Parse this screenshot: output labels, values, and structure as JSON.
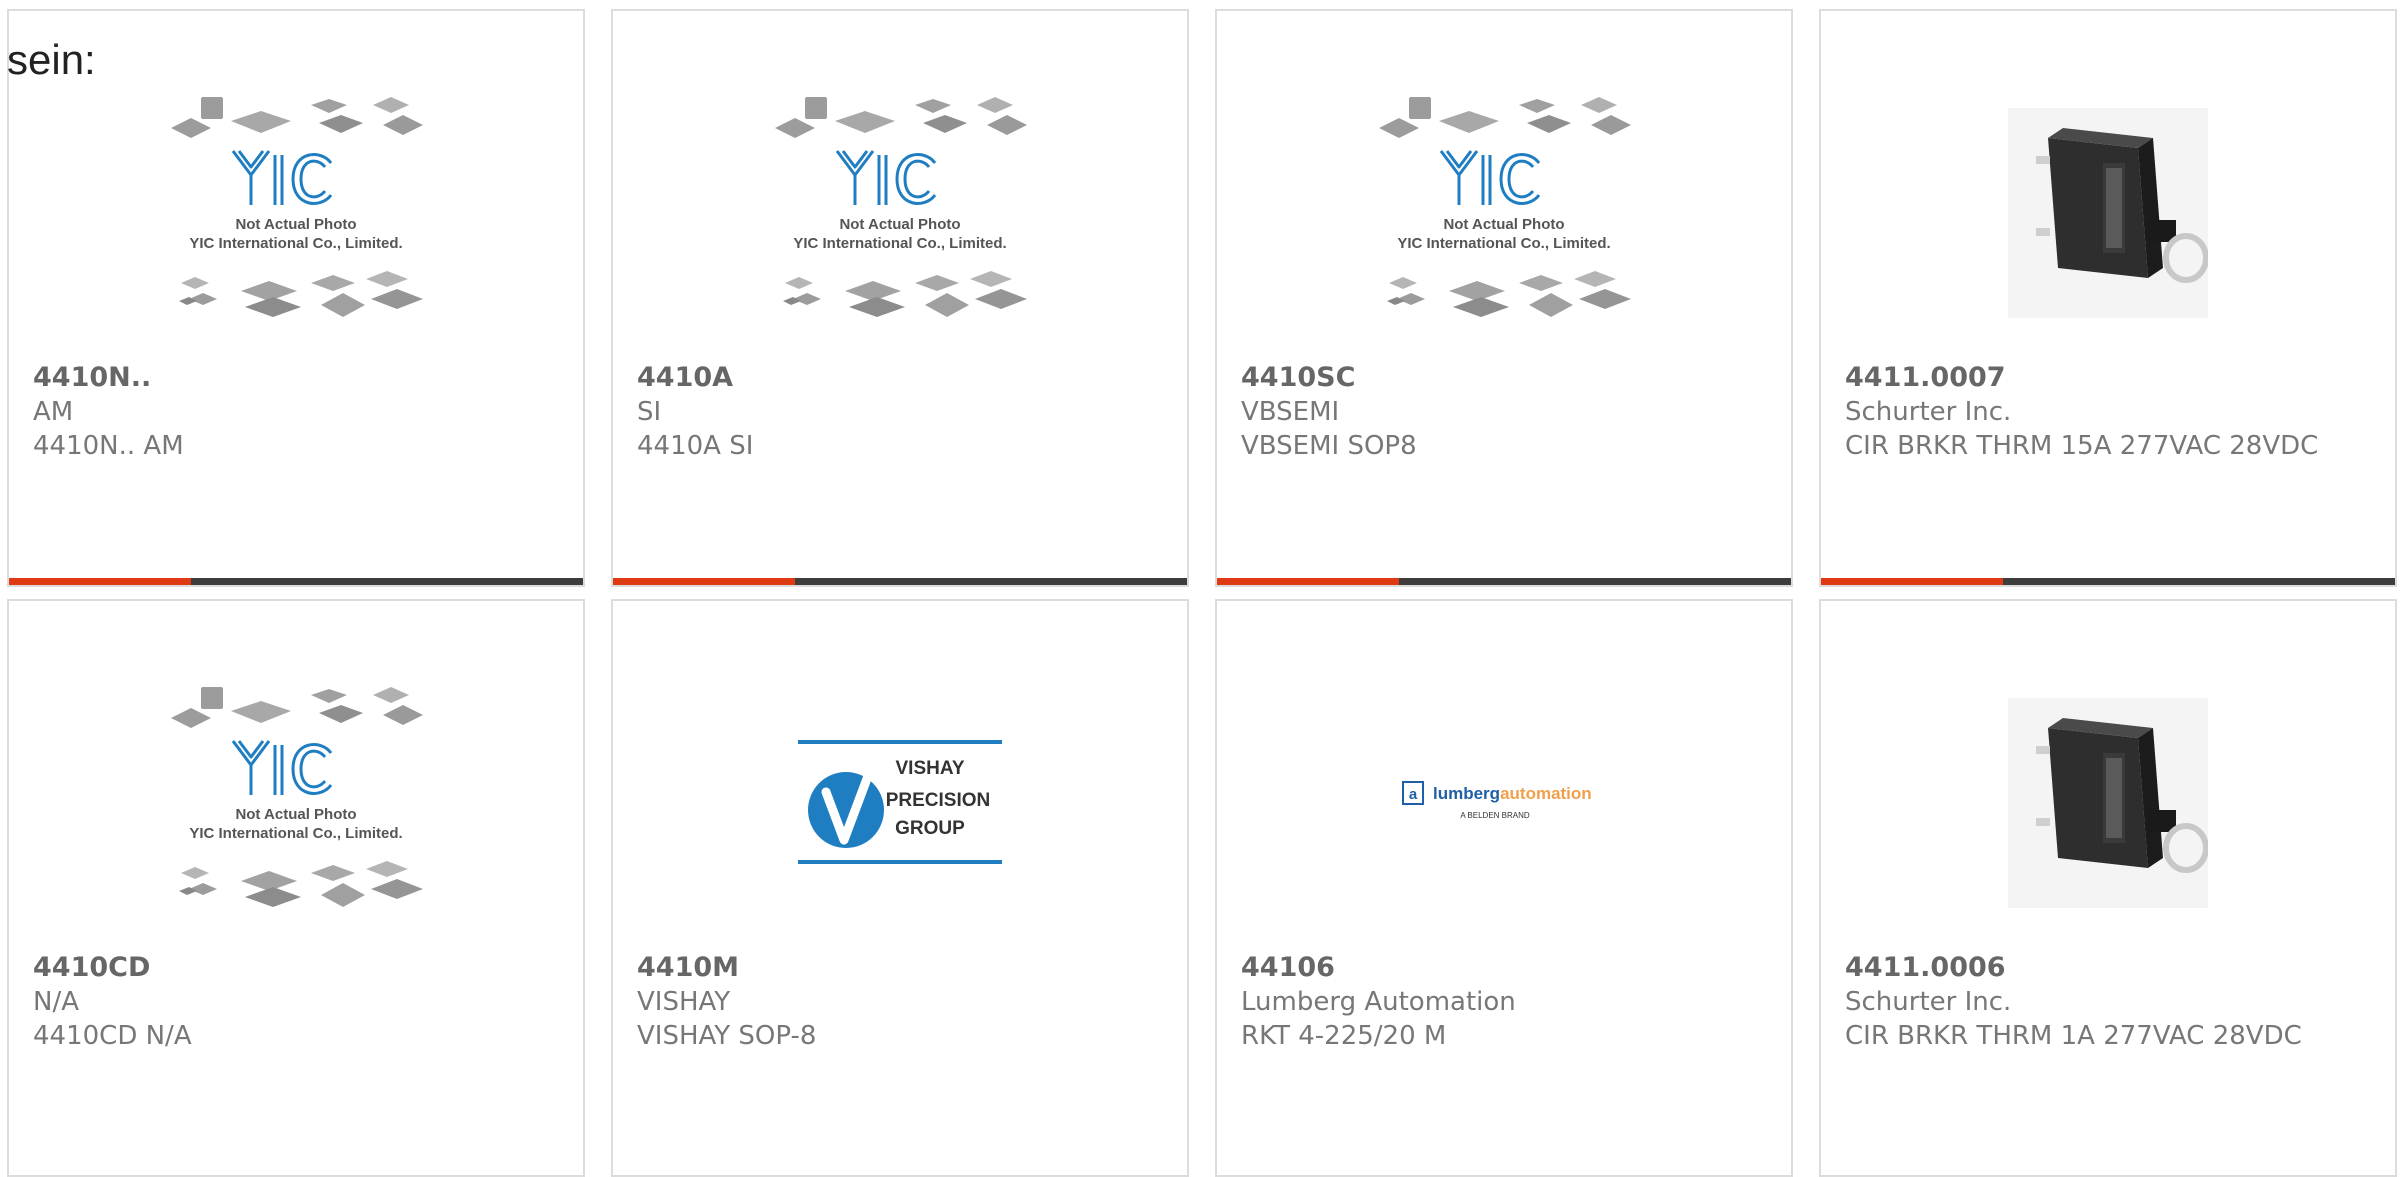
{
  "lead_text": "sein:",
  "brand": {
    "accent": "#e03a14",
    "bar": "#3d3d3d",
    "yic_blue": "#1f7ec2"
  },
  "yic_placeholder": {
    "line1": "Not Actual Photo",
    "line2": "YIC International Co., Limited."
  },
  "vishay_logo": {
    "line1": "VISHAY",
    "line2": "PRECISION",
    "line3": "GROUP"
  },
  "lumberg_logo": {
    "brand_a": "lumberg",
    "brand_b": "automation",
    "tagline": "A BELDEN BRAND"
  },
  "products": [
    {
      "pn": "4410N..",
      "mfr": "AM",
      "desc": "4410N.. AM",
      "image": "yic-placeholder-icon"
    },
    {
      "pn": "4410A",
      "mfr": "SI",
      "desc": "4410A SI",
      "image": "yic-placeholder-icon"
    },
    {
      "pn": "4410SC",
      "mfr": "VBSEMI",
      "desc": "VBSEMI SOP8",
      "image": "yic-placeholder-icon"
    },
    {
      "pn": "4411.0007",
      "mfr": "Schurter Inc.",
      "desc": "CIR BRKR THRM 15A 277VAC 28VDC",
      "image": "circuit-breaker-photo"
    },
    {
      "pn": "4410CD",
      "mfr": "N/A",
      "desc": "4410CD N/A",
      "image": "yic-placeholder-icon"
    },
    {
      "pn": "4410M",
      "mfr": "VISHAY",
      "desc": "VISHAY SOP-8",
      "image": "vishay-logo"
    },
    {
      "pn": "44106",
      "mfr": "Lumberg Automation",
      "desc": "RKT 4-225/20 M",
      "image": "lumberg-logo"
    },
    {
      "pn": "4411.0006",
      "mfr": "Schurter Inc.",
      "desc": "CIR BRKR THRM 1A 277VAC 28VDC",
      "image": "circuit-breaker-photo"
    }
  ]
}
